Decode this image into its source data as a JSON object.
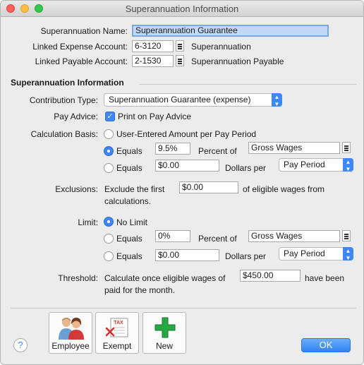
{
  "window": {
    "title": "Superannuation Information"
  },
  "header": {
    "name_label": "Superannuation Name:",
    "name_value": "Superannuation Guarantee",
    "expense_label": "Linked Expense Account:",
    "expense_value": "6-3120",
    "expense_name": "Superannuation",
    "payable_label": "Linked Payable Account:",
    "payable_value": "2-1530",
    "payable_name": "Superannuation Payable"
  },
  "info": {
    "section_title": "Superannuation Information",
    "contribution_label": "Contribution Type:",
    "contribution_value": "Superannuation Guarantee (expense)",
    "pay_advice_label": "Pay Advice:",
    "pay_advice_option": "Print on Pay Advice",
    "pay_advice_checked": true,
    "calc_label": "Calculation Basis:",
    "calc_user_entered": "User-Entered Amount per Pay Period",
    "calc_equals1": "Equals",
    "calc_percent_value": "9.5%",
    "calc_percent_of": "Percent of",
    "calc_percent_base": "Gross Wages",
    "calc_equals2": "Equals",
    "calc_dollars_value": "$0.00",
    "calc_dollars_per": "Dollars per",
    "calc_period": "Pay Period",
    "calc_selected": "percent",
    "exclusions_label": "Exclusions:",
    "exclusions_prefix": "Exclude the first",
    "exclusions_value": "$0.00",
    "exclusions_suffix": "of eligible wages from",
    "exclusions_suffix2": "calculations.",
    "limit_label": "Limit:",
    "limit_none": "No Limit",
    "limit_equals1": "Equals",
    "limit_percent_value": "0%",
    "limit_percent_of": "Percent of",
    "limit_percent_base": "Gross Wages",
    "limit_equals2": "Equals",
    "limit_dollars_value": "$0.00",
    "limit_dollars_per": "Dollars per",
    "limit_period": "Pay Period",
    "limit_selected": "none",
    "threshold_label": "Threshold:",
    "threshold_prefix": "Calculate once eligible wages of",
    "threshold_value": "$450.00",
    "threshold_suffix": "have been",
    "threshold_suffix2": "paid for the month."
  },
  "footer": {
    "help_label": "?",
    "employee_label": "Employee",
    "exempt_label": "Exempt",
    "exempt_tax_text": "TAX",
    "new_label": "New",
    "ok_label": "OK"
  },
  "colors": {
    "accent": "#3f86f7",
    "selection": "#c2d9f5"
  },
  "icons": [
    "lookup-list-icon",
    "employee-people-icon",
    "exempt-tax-icon",
    "new-plus-icon"
  ]
}
